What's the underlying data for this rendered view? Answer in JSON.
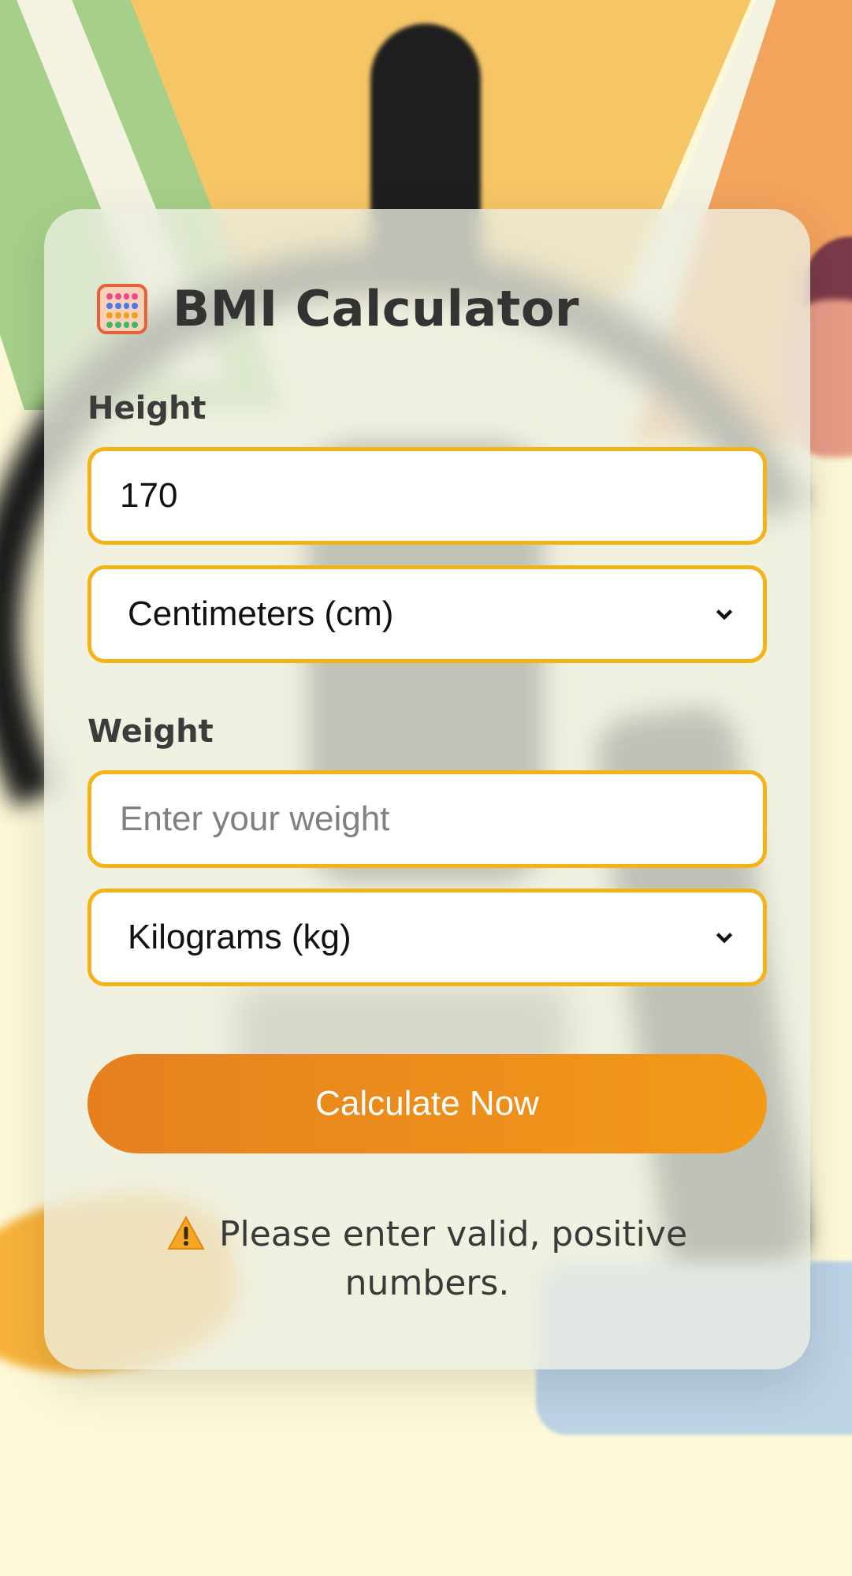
{
  "title": "BMI Calculator",
  "title_icon": "abacus-icon",
  "height": {
    "label": "Height",
    "value": "170",
    "unit_selected": "Centimeters (cm)"
  },
  "weight": {
    "label": "Weight",
    "value": "",
    "placeholder": "Enter your weight",
    "unit_selected": "Kilograms (kg)"
  },
  "calculate_button": "Calculate Now",
  "error_message": "Please enter valid, positive numbers.",
  "error_icon": "warning-icon",
  "colors": {
    "accent_border": "#f2b417",
    "button_start": "#e6801f",
    "button_end": "#f29a18",
    "text": "#333333"
  }
}
